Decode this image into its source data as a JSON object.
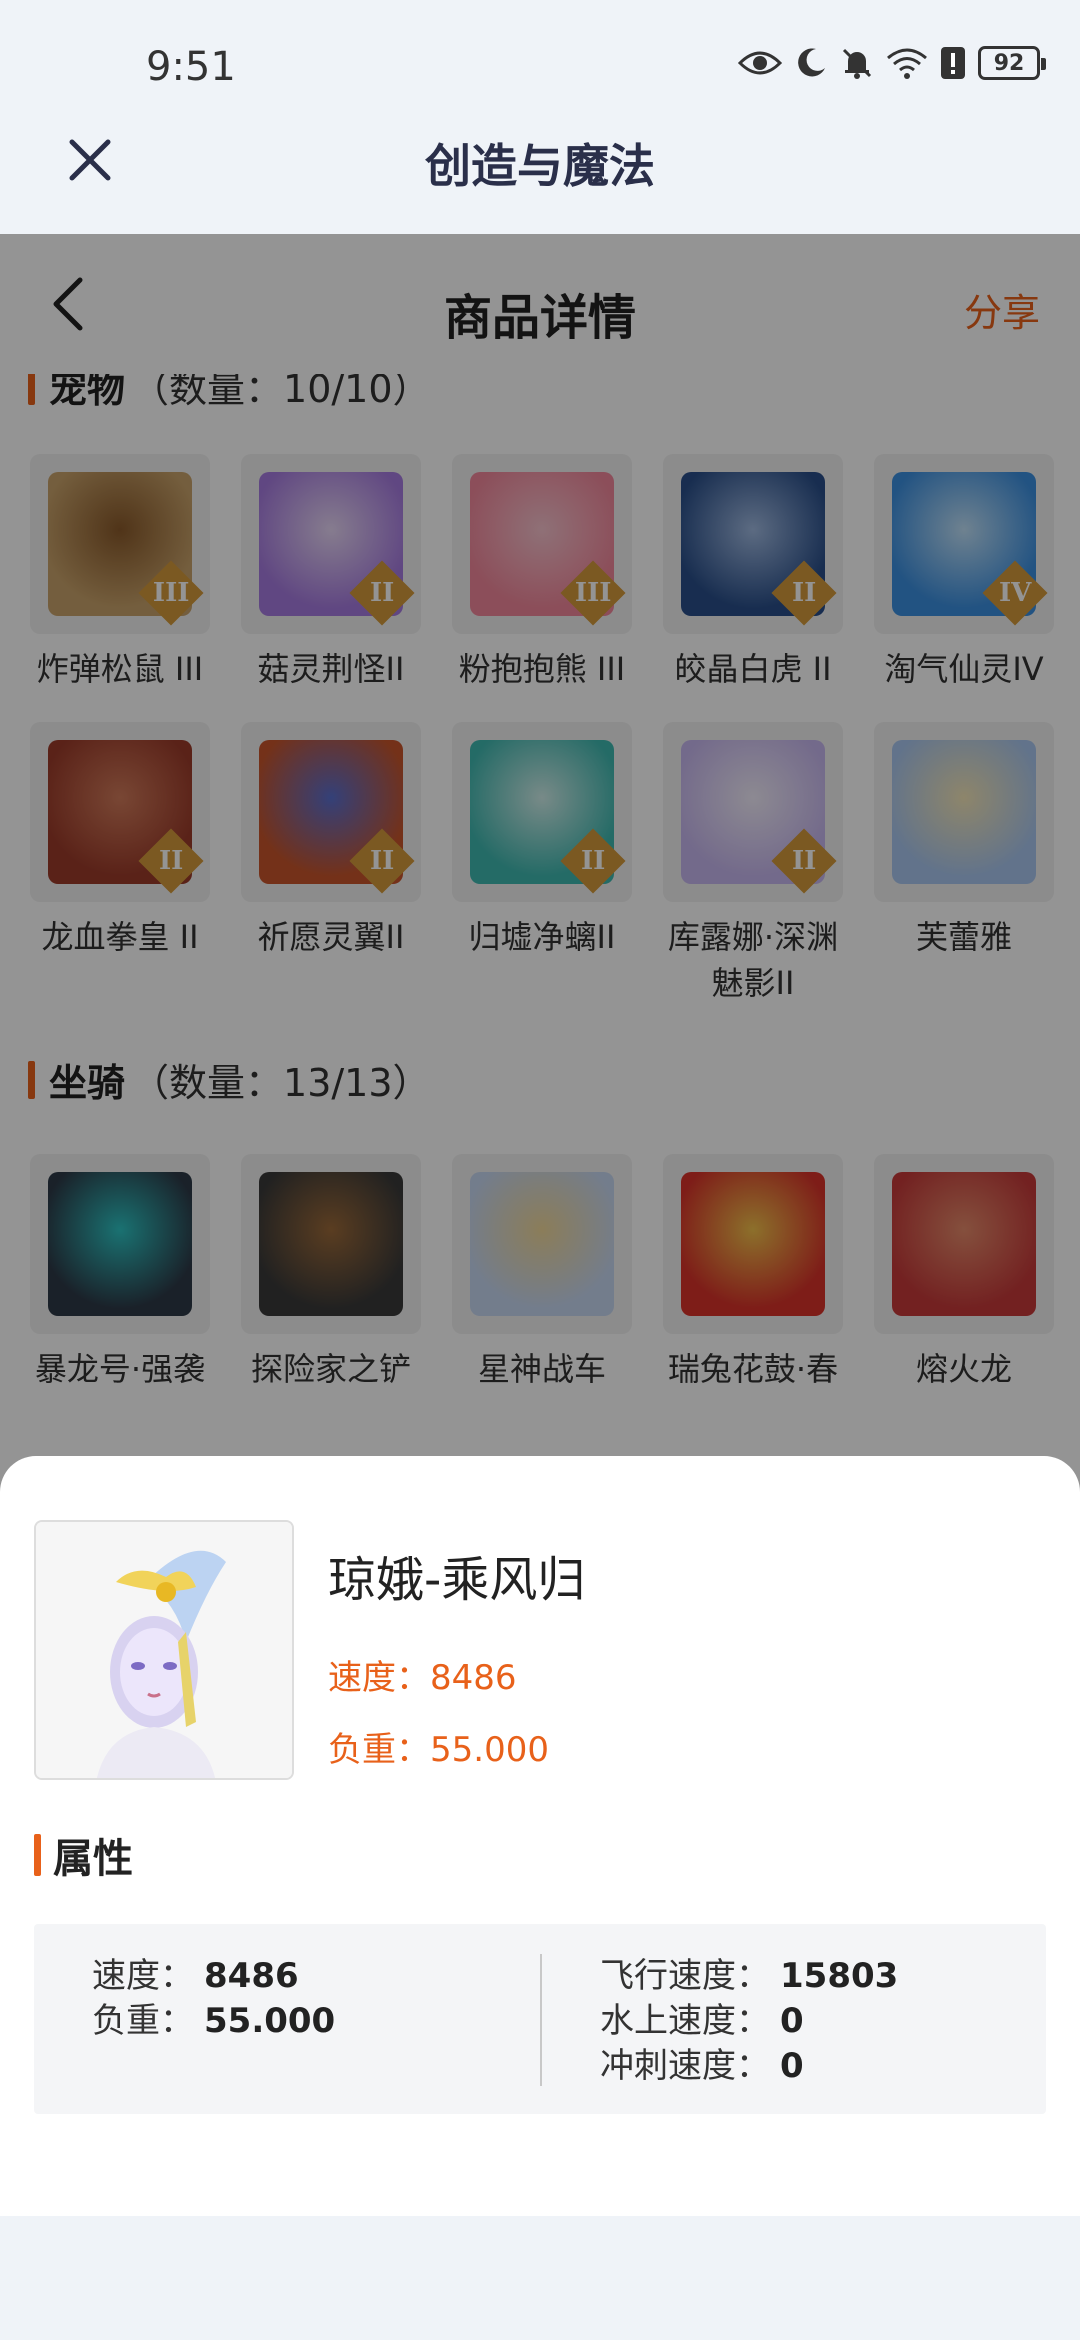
{
  "status": {
    "time": "9:51",
    "battery": "92"
  },
  "appbar": {
    "title": "创造与魔法"
  },
  "page": {
    "title": "商品详情",
    "share_label": "分享"
  },
  "pets": {
    "title": "宠物",
    "count": "（数量：10/10）",
    "items": [
      {
        "name": "炸弹松鼠 III",
        "tier": "III",
        "colors": [
          "#c9a36b",
          "#8a5a2b"
        ]
      },
      {
        "name": "菇灵荆怪II",
        "tier": "II",
        "colors": [
          "#a67be0",
          "#e7d6f5"
        ]
      },
      {
        "name": "粉抱抱熊 III",
        "tier": "III",
        "colors": [
          "#f2879b",
          "#f6c2cd"
        ]
      },
      {
        "name": "皎晶白虎 II",
        "tier": "II",
        "colors": [
          "#2a4f8a",
          "#9fb9e0"
        ]
      },
      {
        "name": "淘气仙灵IV",
        "tier": "IV",
        "colors": [
          "#3b8fe0",
          "#bfe0f8"
        ]
      },
      {
        "name": "龙血拳皇 II",
        "tier": "II",
        "colors": [
          "#9b3b2a",
          "#d07a5a"
        ]
      },
      {
        "name": "祈愿灵翼II",
        "tier": "II",
        "colors": [
          "#c8552b",
          "#5a6fd0"
        ]
      },
      {
        "name": "归墟净螭II",
        "tier": "II",
        "colors": [
          "#3fb8b0",
          "#cfeeea"
        ]
      },
      {
        "name": "库露娜·深渊魅影II",
        "tier": "II",
        "colors": [
          "#c7b7ef",
          "#f2edfb"
        ]
      },
      {
        "name": "芙蕾雅",
        "tier": "",
        "colors": [
          "#a9c7ef",
          "#f4e6b8"
        ]
      }
    ]
  },
  "mounts": {
    "title": "坐骑",
    "count": "（数量：13/13）",
    "items": [
      {
        "name": "暴龙号·强袭",
        "colors": [
          "#2d3a48",
          "#2ec4c4"
        ]
      },
      {
        "name": "探险家之铲",
        "colors": [
          "#3a3a3a",
          "#9c6a3a"
        ]
      },
      {
        "name": "星神战车",
        "colors": [
          "#c7d7f2",
          "#f0d79a"
        ]
      },
      {
        "name": "瑞兔花鼓·春",
        "colors": [
          "#d9322a",
          "#f2c14b"
        ]
      },
      {
        "name": "熔火龙",
        "colors": [
          "#c63a3a",
          "#e58a6a"
        ]
      }
    ]
  },
  "sheet": {
    "name": "琼娥-乘风归",
    "speed_label": "速度：8486",
    "load_label": "负重：55.000",
    "attr_title": "属性",
    "attrs_left": [
      {
        "key": "速度：",
        "value": "8486"
      },
      {
        "key": "负重：",
        "value": "55.000"
      }
    ],
    "attrs_right": [
      {
        "key": "飞行速度：",
        "value": "15803"
      },
      {
        "key": "水上速度：",
        "value": "0"
      },
      {
        "key": "冲刺速度：",
        "value": "0"
      }
    ]
  },
  "colors": {
    "accent": "#e8611a",
    "tier_badge": "#d59a3b"
  }
}
